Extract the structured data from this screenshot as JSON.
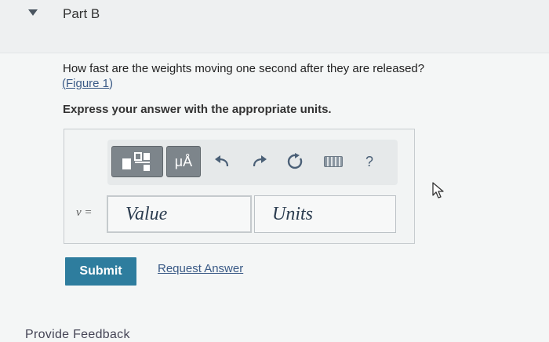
{
  "part": {
    "title": "Part B"
  },
  "question": {
    "text": "How fast are the weights moving one second after they are released?",
    "figure_open": "(",
    "figure_link": "Figure 1",
    "figure_close": ")"
  },
  "instruction": "Express your answer with the appropriate units.",
  "toolbar": {
    "units_label": "μÅ",
    "help_label": "?",
    "icons": [
      "templates-icon",
      "undo-icon",
      "redo-icon",
      "reset-icon",
      "keyboard-icon"
    ]
  },
  "answer": {
    "variable": "v =",
    "value_placeholder": "Value",
    "units_placeholder": "Units"
  },
  "actions": {
    "submit": "Submit",
    "request_answer": "Request Answer"
  },
  "footer": {
    "feedback": "Provide Feedback"
  },
  "colors": {
    "submit": "#2e7d9e",
    "link": "#3a5a86",
    "toolbar_dark": "#7d858b"
  }
}
